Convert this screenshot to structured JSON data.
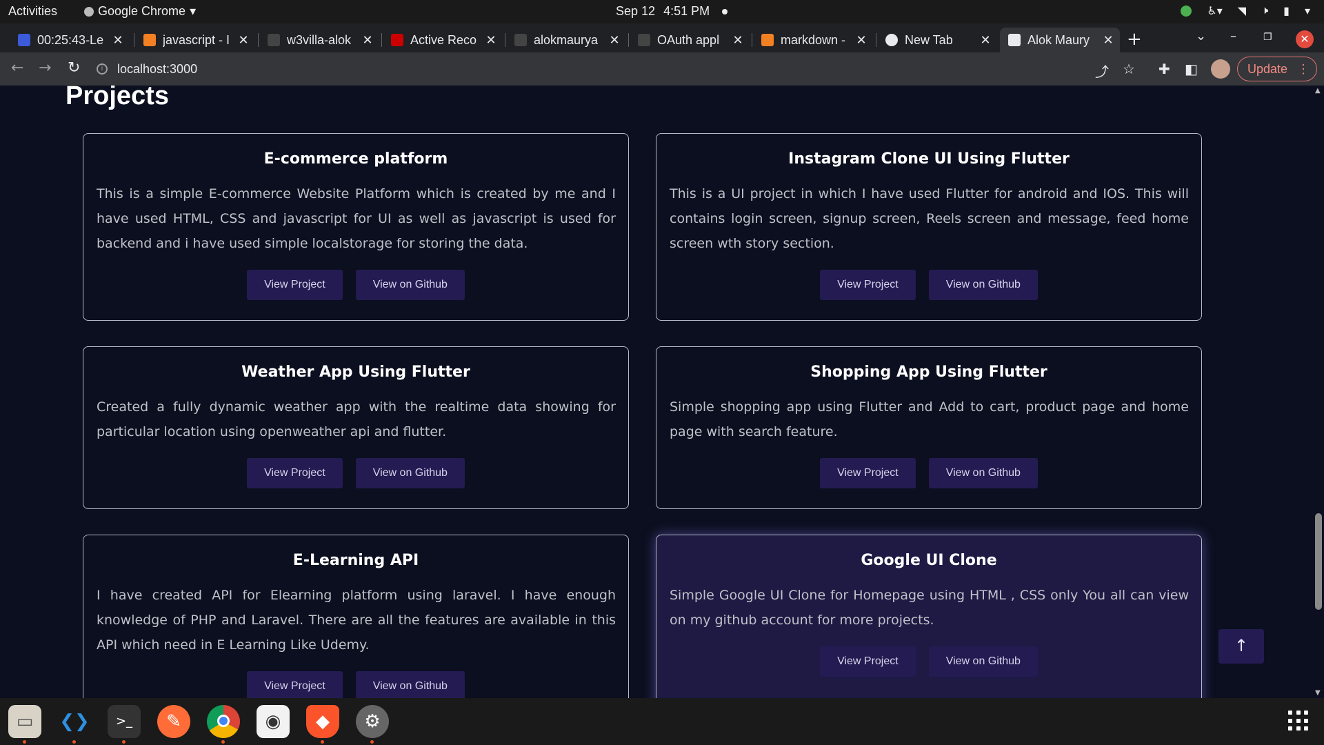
{
  "system_bar": {
    "activities": "Activities",
    "app_name": "Google Chrome",
    "date": "Sep 12",
    "time": "4:51 PM"
  },
  "browser": {
    "tabs": [
      {
        "title": "00:25:43-Le",
        "favicon_color": "#3b5bdb"
      },
      {
        "title": "javascript - I",
        "favicon_color": "#f48024"
      },
      {
        "title": "w3villa-alok",
        "favicon_color": "#444444"
      },
      {
        "title": "Active Reco",
        "favicon_color": "#cc0000"
      },
      {
        "title": "alokmaurya",
        "favicon_color": "#444444"
      },
      {
        "title": "OAuth appl",
        "favicon_color": "#444444"
      },
      {
        "title": "markdown -",
        "favicon_color": "#f48024"
      },
      {
        "title": "New Tab",
        "favicon_color": "#e8eaed"
      },
      {
        "title": "Alok Maury",
        "favicon_color": "#e8eaed"
      }
    ],
    "address": "localhost:3000",
    "update_label": "Update"
  },
  "page": {
    "section_title": "Projects",
    "projects": [
      {
        "title": "E-commerce platform",
        "description": "This is a simple E-commerce Website Platform which is created by me and I have used HTML, CSS and javascript for UI as well as javascript is used for backend and i have used simple localstorage for storing the data.",
        "view_label": "View Project",
        "github_label": "View on Github"
      },
      {
        "title": "Instagram Clone UI Using Flutter",
        "description": "This is a UI project in which I have used Flutter for android and IOS. This will contains login screen, signup screen, Reels screen and message, feed home screen wth story section.",
        "view_label": "View Project",
        "github_label": "View on Github"
      },
      {
        "title": "Weather App Using Flutter",
        "description": "Created a fully dynamic weather app with the realtime data showing for particular location using openweather api and flutter.",
        "view_label": "View Project",
        "github_label": "View on Github"
      },
      {
        "title": "Shopping App Using Flutter",
        "description": "Simple shopping app using Flutter and Add to cart, product page and home page with search feature.",
        "view_label": "View Project",
        "github_label": "View on Github"
      },
      {
        "title": "E-Learning API",
        "description": "I have created API for Elearning platform using laravel. I have enough knowledge of PHP and Laravel. There are all the features are available in this API which need in E Learning Like Udemy.",
        "view_label": "View Project",
        "github_label": "View on Github"
      },
      {
        "title": "Google UI Clone",
        "description": "Simple Google UI Clone for Homepage using HTML , CSS only You all can view on my github account for more projects.",
        "view_label": "View Project",
        "github_label": "View on Github"
      }
    ]
  },
  "dock": {
    "apps": [
      "files-icon",
      "vscode-icon",
      "terminal-icon",
      "postman-icon",
      "chrome-icon",
      "mongodb-compass-icon",
      "brave-icon",
      "settings-icon"
    ]
  }
}
